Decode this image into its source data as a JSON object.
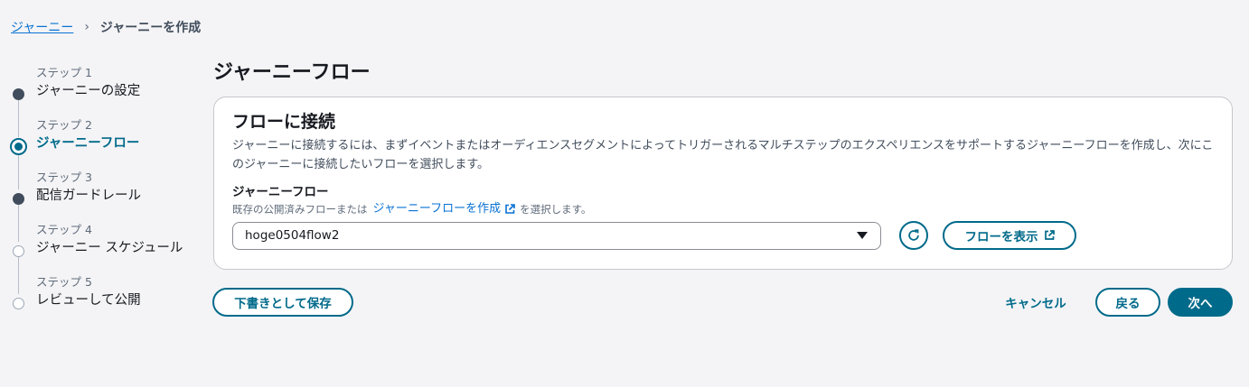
{
  "breadcrumb": {
    "root": "ジャーニー",
    "separator": "›",
    "current": "ジャーニーを作成"
  },
  "steps": [
    {
      "num": "ステップ 1",
      "label": "ジャーニーの設定",
      "state": "done"
    },
    {
      "num": "ステップ 2",
      "label": "ジャーニーフロー",
      "state": "active"
    },
    {
      "num": "ステップ 3",
      "label": "配信ガードレール",
      "state": "done"
    },
    {
      "num": "ステップ 4",
      "label": "ジャーニー スケジュール",
      "state": "future"
    },
    {
      "num": "ステップ 5",
      "label": "レビューして公開",
      "state": "future"
    }
  ],
  "page_title": "ジャーニーフロー",
  "panel": {
    "title": "フローに接続",
    "description": "ジャーニーに接続するには、まずイベントまたはオーディエンスセグメントによってトリガーされるマルチステップのエクスペリエンスをサポートするジャーニーフローを作成し、次にこのジャーニーに接続したいフローを選択します。",
    "field_label": "ジャーニーフロー",
    "hint_prefix": "既存の公開済みフローまたは",
    "hint_link": "ジャーニーフローを作成",
    "hint_suffix": "を選択します。",
    "select_value": "hoge0504flow2",
    "view_flow_label": "フローを表示"
  },
  "footer": {
    "save_draft_label": "下書きとして保存",
    "cancel_label": "キャンセル",
    "back_label": "戻る",
    "next_label": "次へ"
  },
  "colors": {
    "accent": "#006a8a",
    "link": "#0972d3",
    "background": "#f4f4f6"
  }
}
